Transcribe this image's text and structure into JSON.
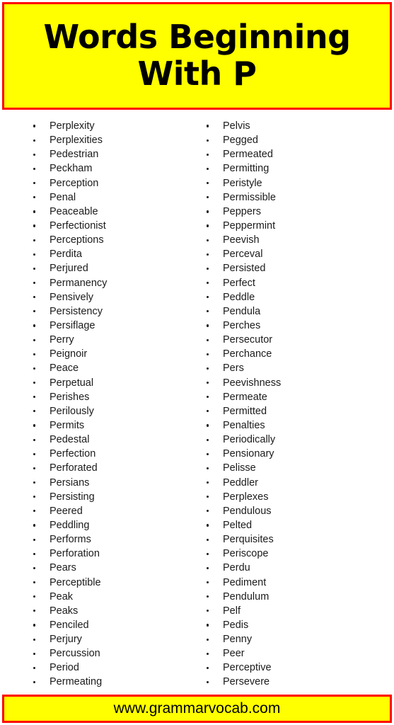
{
  "theme": {
    "banner_background": "#ffff00",
    "banner_border": "#ff0000",
    "page_background": "#ffffff",
    "text_color": "#1b1b1b",
    "heading_color": "#000000"
  },
  "header": {
    "title": "Words Beginning\nWith P"
  },
  "columns": [
    {
      "name": "left-column",
      "words": [
        "Perplexity",
        "Perplexities",
        "Pedestrian",
        "Peckham",
        "Perception",
        "Penal",
        "Peaceable",
        "Perfectionist",
        "Perceptions",
        "Perdita",
        "Perjured",
        "Permanency",
        "Pensively",
        "Persistency",
        "Persiflage",
        "Perry",
        "Peignoir",
        "Peace",
        "Perpetual",
        "Perishes",
        "Perilously",
        "Permits",
        "Pedestal",
        "Perfection",
        "Perforated",
        "Persians",
        "Persisting",
        "Peered",
        "Peddling",
        "Performs",
        "Perforation",
        "Pears",
        "Perceptible",
        "Peak",
        "Peaks",
        "Penciled",
        "Perjury",
        "Percussion",
        "Period",
        "Permeating"
      ]
    },
    {
      "name": "right-column",
      "words": [
        "Pelvis",
        "Pegged",
        "Permeated",
        "Permitting",
        "Peristyle",
        "Permissible",
        "Peppers",
        "Peppermint",
        "Peevish",
        "Perceval",
        "Persisted",
        "Perfect",
        "Peddle",
        "Pendula",
        "Perches",
        "Persecutor",
        "Perchance",
        "Pers",
        "Peevishness",
        "Permeate",
        "Permitted",
        "Penalties",
        "Periodically",
        "Pensionary",
        "Pelisse",
        "Peddler",
        "Perplexes",
        "Pendulous",
        "Pelted",
        "Perquisites",
        "Periscope",
        "Perdu",
        "Pediment",
        "Pendulum",
        "Pelf",
        "Pedis",
        "Penny",
        "Peer",
        "Perceptive",
        "Persevere"
      ]
    }
  ],
  "footer": {
    "website": "www.grammarvocab.com"
  }
}
